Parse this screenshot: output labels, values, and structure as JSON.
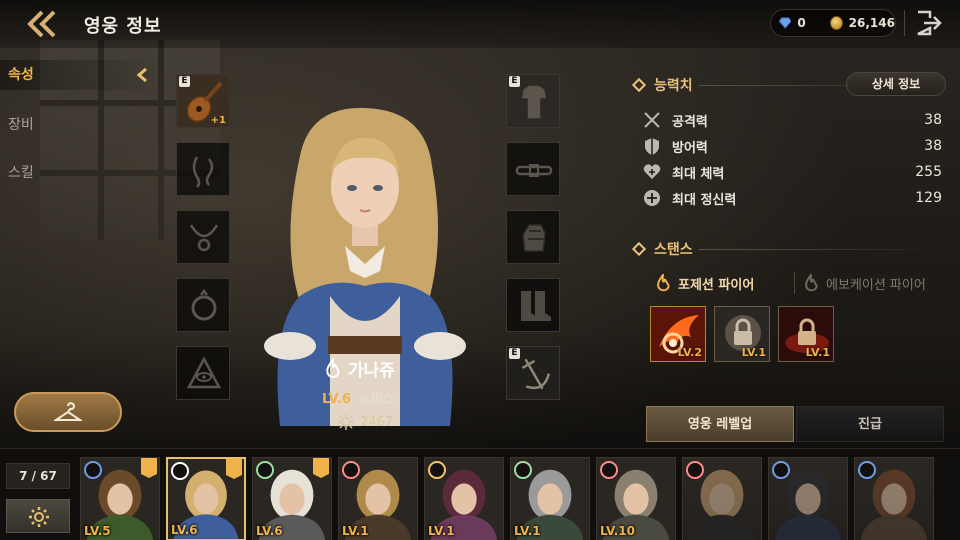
{
  "header": {
    "title": "영웅 정보",
    "gems": "0",
    "gold": "26,146"
  },
  "tabs": [
    {
      "label": "속성",
      "active": true
    },
    {
      "label": "장비",
      "active": false
    },
    {
      "label": "스킬",
      "active": false
    }
  ],
  "equipment": {
    "left": [
      {
        "icon": "lute-icon",
        "equipped": true,
        "badge": "E",
        "bonus": "+1"
      },
      {
        "icon": "earring-icon",
        "equipped": false
      },
      {
        "icon": "necklace-icon",
        "equipped": false
      },
      {
        "icon": "ring-icon",
        "equipped": false
      },
      {
        "icon": "eye-sigil-icon",
        "equipped": false
      }
    ],
    "right": [
      {
        "icon": "armor-icon",
        "equipped": true,
        "badge": "E"
      },
      {
        "icon": "belt-icon",
        "equipped": false
      },
      {
        "icon": "gauntlet-icon",
        "equipped": false
      },
      {
        "icon": "boots-icon",
        "equipped": false
      },
      {
        "icon": "anchor-icon",
        "equipped": true,
        "badge": "E"
      }
    ]
  },
  "hero": {
    "name": "가나쥬",
    "level": "LV.6",
    "rank": "노비스",
    "power": "2467",
    "element_color": "#d6a4ff"
  },
  "stats_section": {
    "title": "능력치",
    "detail_button": "상세 정보",
    "stats": [
      {
        "icon": "swords-icon",
        "label": "공격력",
        "value": "38"
      },
      {
        "icon": "shield-icon",
        "label": "방어력",
        "value": "38"
      },
      {
        "icon": "heart-icon",
        "label": "최대 체력",
        "value": "255"
      },
      {
        "icon": "spirit-icon",
        "label": "최대 정신력",
        "value": "129"
      }
    ]
  },
  "stance_section": {
    "title": "스탠스",
    "tabs": [
      {
        "label": "포제션 파이어",
        "active": true
      },
      {
        "label": "에보케이션 파이어",
        "active": false
      }
    ],
    "skills": [
      {
        "icon": "fire-swirl-skill-icon",
        "level": "LV.2",
        "locked": false
      },
      {
        "icon": "locked-skill-icon",
        "level": "LV.1",
        "locked": true
      },
      {
        "icon": "locked-fire-skill-icon",
        "level": "LV.1",
        "locked": true
      }
    ]
  },
  "actions": {
    "level_up": "영웅 레벨업",
    "promote": "진급"
  },
  "roster": {
    "count": "7 / 67",
    "heroes": [
      {
        "level": "LV.5",
        "element": "blue",
        "crest": true,
        "selected": false,
        "owned": true
      },
      {
        "level": "LV.6",
        "element": "fire",
        "crest": true,
        "selected": true,
        "owned": true
      },
      {
        "level": "LV.6",
        "element": "green",
        "crest": true,
        "selected": false,
        "owned": true
      },
      {
        "level": "LV.1",
        "element": "red",
        "crest": false,
        "selected": false,
        "owned": true
      },
      {
        "level": "LV.1",
        "element": "sun",
        "crest": false,
        "selected": false,
        "owned": true
      },
      {
        "level": "LV.1",
        "element": "green",
        "crest": false,
        "selected": false,
        "owned": true
      },
      {
        "level": "LV.10",
        "element": "red",
        "crest": false,
        "selected": false,
        "owned": true
      },
      {
        "level": "",
        "element": "red",
        "crest": false,
        "selected": false,
        "owned": false
      },
      {
        "level": "",
        "element": "blue",
        "crest": false,
        "selected": false,
        "owned": false
      },
      {
        "level": "",
        "element": "blue",
        "crest": false,
        "selected": false,
        "owned": false
      }
    ]
  },
  "colors": {
    "accent_gold": "#f0b24a",
    "section_title": "#e9c27b",
    "selected_border": "#e8c16e"
  }
}
